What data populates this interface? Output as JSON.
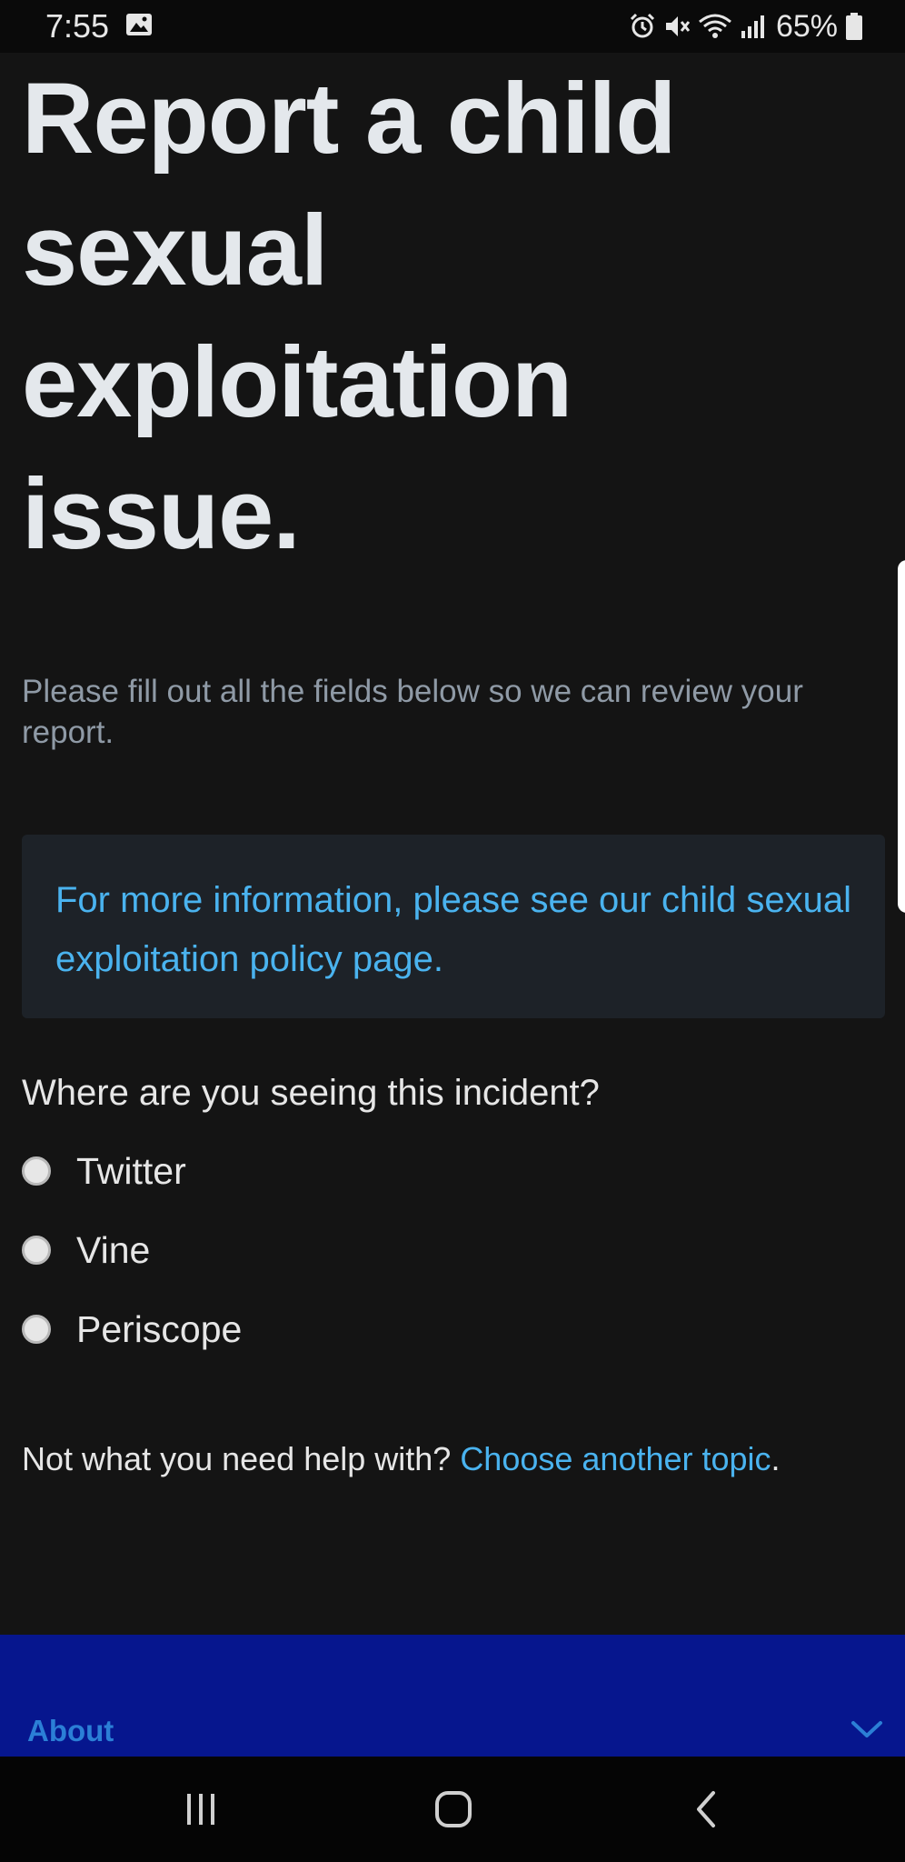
{
  "status_bar": {
    "time": "7:55",
    "battery": "65%",
    "icons": [
      "image-icon",
      "alarm-icon",
      "mute-icon",
      "wifi-icon",
      "signal-icon",
      "battery-icon"
    ]
  },
  "page": {
    "title": "Report a child sexual exploitation issue.",
    "intro": "Please fill out all the fields below so we can review your report.",
    "info_box": {
      "prefix": "For more information, please see our ",
      "link_text": "child sexual exploitation policy page",
      "suffix": "."
    },
    "question": "Where are you seeing this incident?",
    "options": [
      "Twitter",
      "Vine",
      "Periscope"
    ],
    "help": {
      "prefix": "Not what you need help with? ",
      "link_text": "Choose another topic",
      "suffix": "."
    }
  },
  "footer": {
    "about_label": "About"
  },
  "colors": {
    "background": "#141414",
    "link": "#4ab3ef",
    "footer": "#06168e"
  },
  "nav_bar": {
    "icons": [
      "recent-apps-icon",
      "home-icon",
      "back-icon"
    ]
  }
}
